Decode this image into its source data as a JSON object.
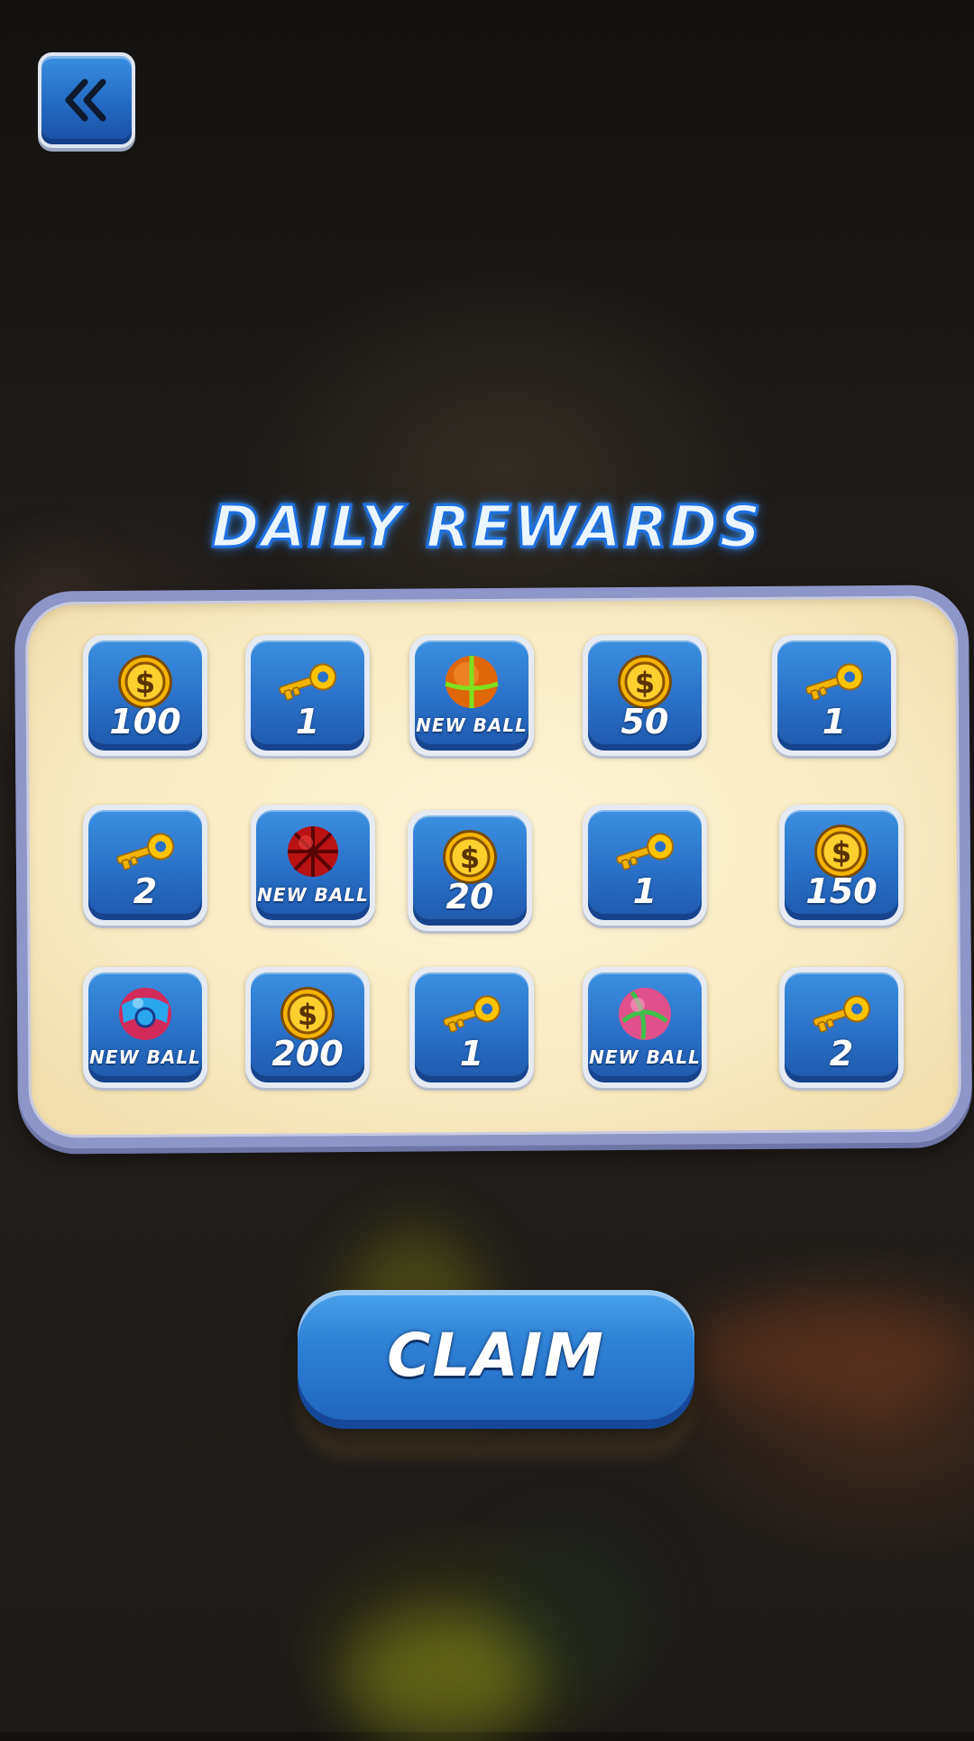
{
  "header": {
    "back_icon": "double-chevron-left-icon"
  },
  "title": "DAILY REWARDS",
  "rewards": [
    {
      "type": "coin",
      "icon": "coin-icon",
      "label": "100"
    },
    {
      "type": "key",
      "icon": "key-icon",
      "label": "1"
    },
    {
      "type": "ball",
      "icon": "ball-orange-icon",
      "label": "NEW BALL"
    },
    {
      "type": "coin",
      "icon": "coin-icon",
      "label": "50"
    },
    {
      "type": "key",
      "icon": "key-icon",
      "label": "1"
    },
    {
      "type": "key",
      "icon": "key-icon",
      "label": "2"
    },
    {
      "type": "ball",
      "icon": "ball-red-icon",
      "label": "NEW BALL"
    },
    {
      "type": "coin",
      "icon": "coin-icon",
      "label": "20"
    },
    {
      "type": "key",
      "icon": "key-icon",
      "label": "1"
    },
    {
      "type": "coin",
      "icon": "coin-icon",
      "label": "150"
    },
    {
      "type": "ball",
      "icon": "ball-blue-icon",
      "label": "NEW BALL"
    },
    {
      "type": "coin",
      "icon": "coin-icon",
      "label": "200"
    },
    {
      "type": "key",
      "icon": "key-icon",
      "label": "1"
    },
    {
      "type": "ball",
      "icon": "ball-pink-icon",
      "label": "NEW BALL"
    },
    {
      "type": "key",
      "icon": "key-icon",
      "label": "2"
    }
  ],
  "claim_button": {
    "label": "CLAIM"
  },
  "colors": {
    "tile_blue": "#2a70c8",
    "panel_cream": "#f8ebc2",
    "title_glow": "#1e6fe0",
    "coin_gold": "#f6b400"
  }
}
